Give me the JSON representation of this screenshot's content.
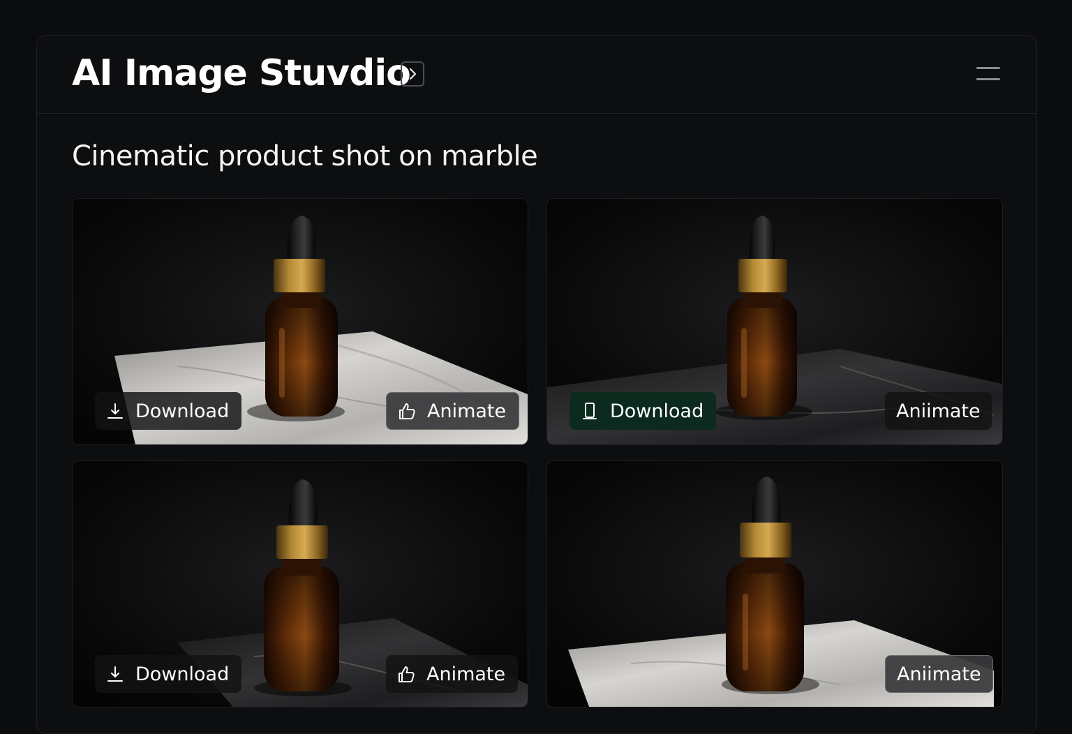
{
  "app": {
    "title": "AI Image Stuvdio",
    "expand_icon": "chevron-right-icon",
    "menu_icon": "menu-icon"
  },
  "prompt": "Cinematic product shot on marble",
  "colors": {
    "background": "#0b0c0e",
    "panel": "#0d0e10",
    "bottle_amber": "#7a3d0c",
    "bottle_cap_gold": "#b0852d",
    "marble_white": "#d4d2ce",
    "marble_black": "#2a2a2c",
    "download_active": "#0c2a1e"
  },
  "images": [
    {
      "description": "amber dropper bottle on white marble slab",
      "marble": "white",
      "download": {
        "label": "Download",
        "icon": "download-icon"
      },
      "animate": {
        "label": "Animate",
        "icon": "thumbs-up-icon"
      }
    },
    {
      "description": "amber dropper bottle on black marble slab",
      "marble": "black",
      "download": {
        "label": "Download",
        "icon": "phone-icon"
      },
      "animate": {
        "label": "Aniimate"
      }
    },
    {
      "description": "amber dropper bottle on black marble slab",
      "marble": "black",
      "download": {
        "label": "Download",
        "icon": "download-icon"
      },
      "animate": {
        "label": "Animate",
        "icon": "thumbs-up-icon"
      }
    },
    {
      "description": "amber dropper bottle on white marble slab",
      "marble": "white",
      "animate": {
        "label": "Aniimate"
      }
    }
  ]
}
